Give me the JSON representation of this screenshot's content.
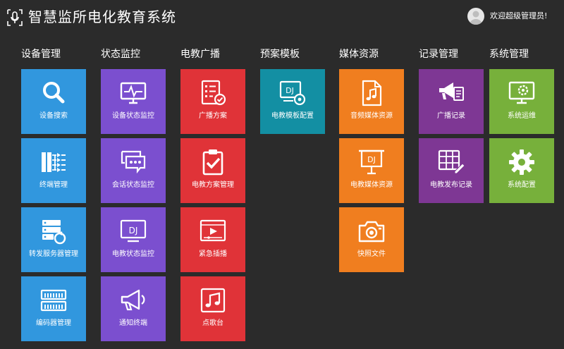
{
  "app": {
    "title": "智慧监所电化教育系统"
  },
  "user": {
    "welcome": "欢迎超级管理员!"
  },
  "colors": {
    "blue": "#3197de",
    "purple": "#7b4fcf",
    "red": "#e03338",
    "teal": "#138fa3",
    "orange": "#f07e1f",
    "magenta": "#7e3794",
    "green": "#77b03b"
  },
  "columns": [
    {
      "title": "设备管理",
      "tiles": [
        {
          "label": "设备搜索",
          "icon": "magnifier-icon",
          "color": "#3197de"
        },
        {
          "label": "终端管理",
          "icon": "device-tree-icon",
          "color": "#3197de"
        },
        {
          "label": "转发服务器管理",
          "icon": "server-icon",
          "color": "#3197de"
        },
        {
          "label": "编码器管理",
          "icon": "encoder-icon",
          "color": "#3197de"
        }
      ]
    },
    {
      "title": "状态监控",
      "tiles": [
        {
          "label": "设备状态监控",
          "icon": "monitor-pulse-icon",
          "color": "#7b4fcf"
        },
        {
          "label": "会话状态监控",
          "icon": "chat-bubbles-icon",
          "color": "#7b4fcf"
        },
        {
          "label": "电教状态监控",
          "icon": "dj-screen-icon",
          "color": "#7b4fcf"
        },
        {
          "label": "通知终端",
          "icon": "megaphone-icon",
          "color": "#7b4fcf"
        }
      ]
    },
    {
      "title": "电教广播",
      "tiles": [
        {
          "label": "广播方案",
          "icon": "checklist-icon",
          "color": "#e03338"
        },
        {
          "label": "电教方案管理",
          "icon": "clipboard-check-icon",
          "color": "#e03338"
        },
        {
          "label": "紧急插播",
          "icon": "video-player-icon",
          "color": "#e03338"
        },
        {
          "label": "点歌台",
          "icon": "music-note-icon",
          "color": "#e03338"
        }
      ]
    },
    {
      "title": "预案模板",
      "tiles": [
        {
          "label": "电教模板配置",
          "icon": "dj-gear-icon",
          "color": "#138fa3"
        }
      ]
    },
    {
      "title": "媒体资源",
      "tiles": [
        {
          "label": "音频媒体资源",
          "icon": "audio-file-icon",
          "color": "#f07e1f"
        },
        {
          "label": "电教媒体资源",
          "icon": "dj-board-icon",
          "color": "#f07e1f"
        },
        {
          "label": "快照文件",
          "icon": "camera-icon",
          "color": "#f07e1f"
        }
      ]
    },
    {
      "title": "记录管理",
      "tiles": [
        {
          "label": "广播记录",
          "icon": "broadcast-log-icon",
          "color": "#7e3794"
        },
        {
          "label": "电教发布记录",
          "icon": "table-edit-icon",
          "color": "#7e3794"
        }
      ]
    },
    {
      "title": "系统管理",
      "tiles": [
        {
          "label": "系统运维",
          "icon": "monitor-gear-icon",
          "color": "#77b03b"
        },
        {
          "label": "系统配置",
          "icon": "gear-icon",
          "color": "#77b03b"
        }
      ]
    }
  ]
}
